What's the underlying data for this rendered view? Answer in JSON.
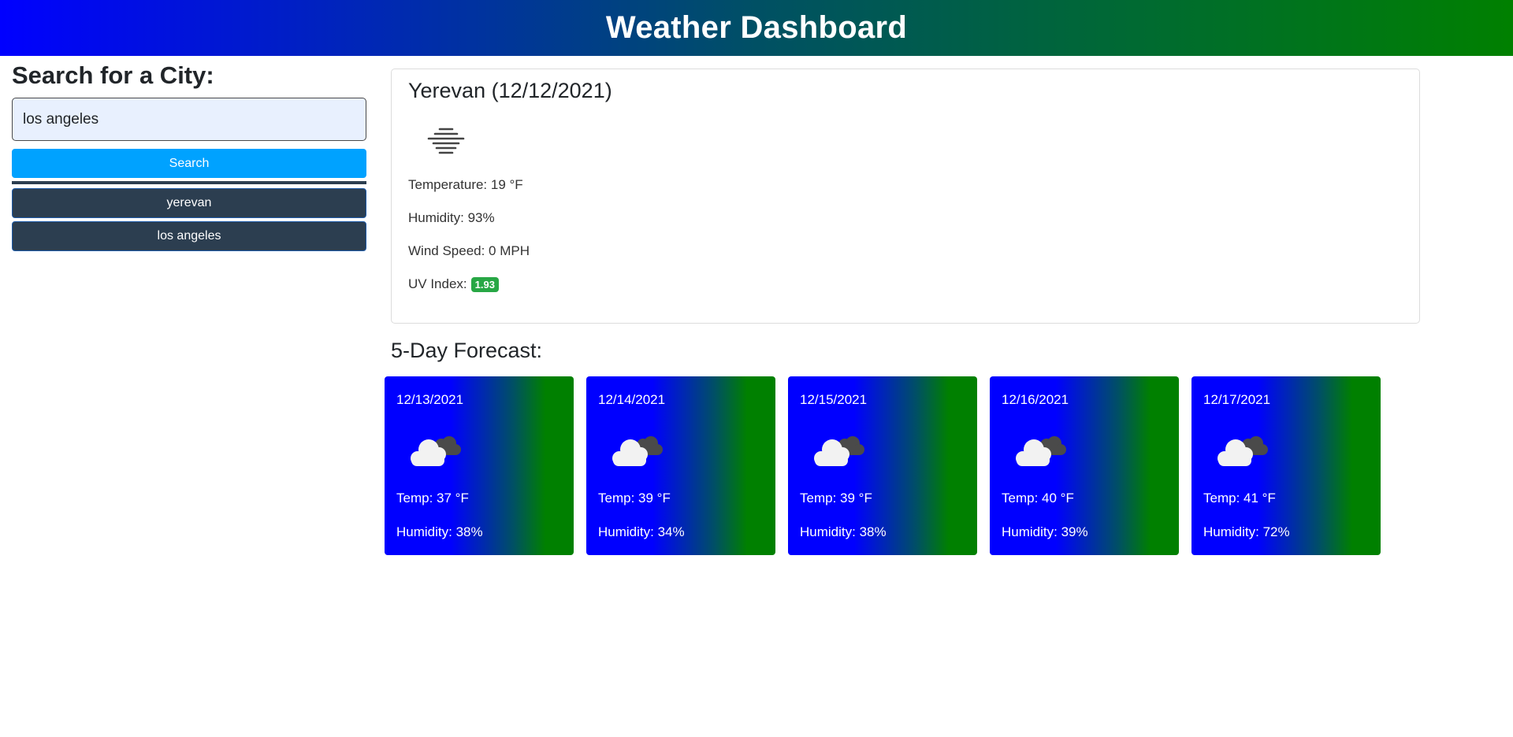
{
  "header": {
    "title": "Weather Dashboard"
  },
  "sidebar": {
    "heading": "Search for a City:",
    "search_value": "los angeles",
    "search_button": "Search",
    "history": [
      "yerevan",
      "los angeles"
    ]
  },
  "current": {
    "title": "Yerevan (12/12/2021)",
    "icon": "mist-icon",
    "temperature": "Temperature: 19 °F",
    "humidity": "Humidity: 93%",
    "wind": "Wind Speed: 0 MPH",
    "uv_label": "UV Index:",
    "uv_value": "1.93",
    "uv_color": "#28a745"
  },
  "forecast": {
    "title": "5-Day Forecast:",
    "days": [
      {
        "date": "12/13/2021",
        "icon": "broken-clouds-icon",
        "temp": "Temp: 37 °F",
        "humidity": "Humidity: 38%"
      },
      {
        "date": "12/14/2021",
        "icon": "broken-clouds-icon",
        "temp": "Temp: 39 °F",
        "humidity": "Humidity: 34%"
      },
      {
        "date": "12/15/2021",
        "icon": "broken-clouds-icon",
        "temp": "Temp: 39 °F",
        "humidity": "Humidity: 38%"
      },
      {
        "date": "12/16/2021",
        "icon": "broken-clouds-icon",
        "temp": "Temp: 40 °F",
        "humidity": "Humidity: 39%"
      },
      {
        "date": "12/17/2021",
        "icon": "broken-clouds-icon",
        "temp": "Temp: 41 °F",
        "humidity": "Humidity: 72%"
      }
    ]
  },
  "colors": {
    "gradient_start": "#0000ff",
    "gradient_end": "#008000",
    "search_button": "#00a2ff",
    "history_button": "#2c3e50"
  }
}
